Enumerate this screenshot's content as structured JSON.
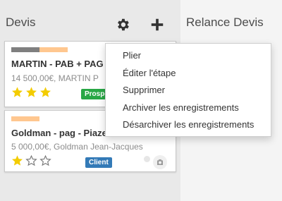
{
  "columns": {
    "devis": {
      "title": "Devis",
      "cards": [
        {
          "title": "MARTIN - PAB + PAG",
          "subtitle": "14 500,00€, MARTIN P",
          "stars": [
            true,
            true,
            true
          ],
          "tag": "Prospect",
          "progress": [
            {
              "color": "#7f7f7f",
              "weight": 40
            },
            {
              "color": "#ffc78f",
              "weight": 40
            }
          ]
        },
        {
          "title": "Goldman - pag - Piazea",
          "subtitle": "5 000,00€, Goldman Jean-Jacques",
          "stars": [
            true,
            false,
            false
          ],
          "tag": "Client",
          "progress": [
            {
              "color": "#ffc78f",
              "weight": 40
            }
          ]
        }
      ]
    },
    "relance": {
      "title": "Relance Devis"
    }
  },
  "column_menu": {
    "items": [
      "Plier",
      "Éditer l'étape",
      "Supprimer",
      "Archiver les enregistrements",
      "Désarchiver les enregistrements"
    ]
  },
  "icons": {
    "settings": "gear-icon",
    "add": "plus-icon",
    "star": "star-icon",
    "avatar": "camera-icon"
  },
  "colors": {
    "star_filled": "#f3cc00",
    "tag_prospect": "#28a745",
    "tag_client": "#337ab7"
  }
}
